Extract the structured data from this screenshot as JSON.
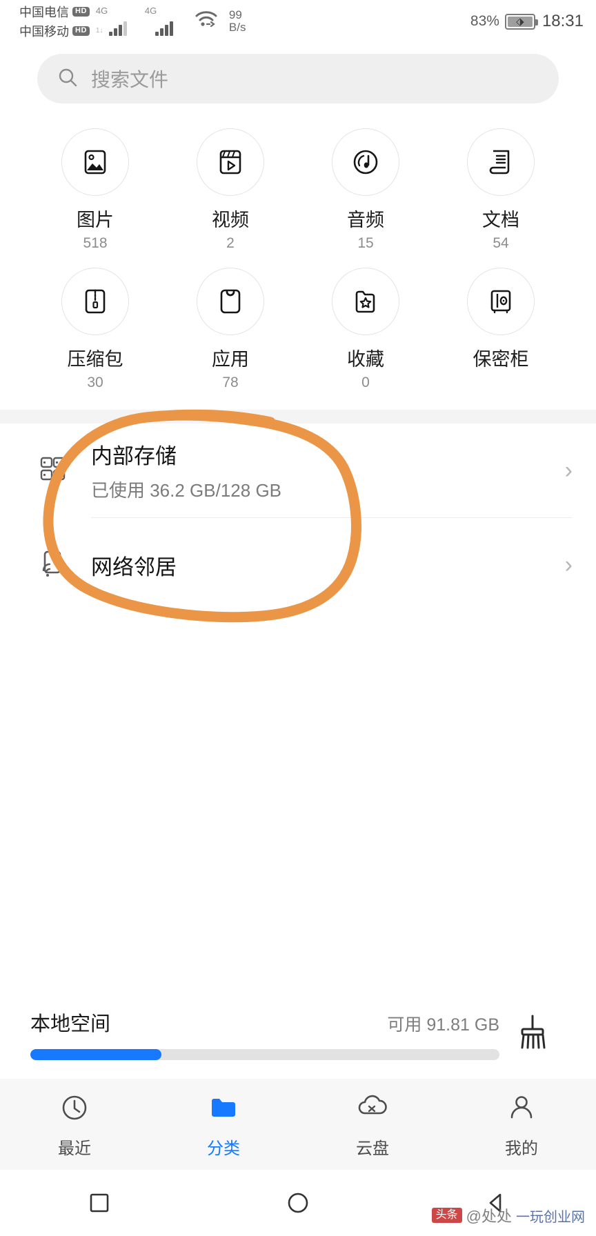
{
  "status_bar": {
    "carrier_1": "中国电信",
    "carrier_1_badge": "HD",
    "carrier_2": "中国移动",
    "carrier_2_badge": "HD",
    "network_1": "4G",
    "network_2": "4G",
    "net_speed_value": "99",
    "net_speed_unit": "B/s",
    "battery_percent": "83%",
    "time": "18:31"
  },
  "search": {
    "placeholder": "搜索文件",
    "icon": "search-icon"
  },
  "categories": [
    {
      "label": "图片",
      "count": "518",
      "icon": "image-icon"
    },
    {
      "label": "视频",
      "count": "2",
      "icon": "video-icon"
    },
    {
      "label": "音频",
      "count": "15",
      "icon": "audio-icon"
    },
    {
      "label": "文档",
      "count": "54",
      "icon": "document-icon"
    },
    {
      "label": "压缩包",
      "count": "30",
      "icon": "archive-icon"
    },
    {
      "label": "应用",
      "count": "78",
      "icon": "app-bag-icon"
    },
    {
      "label": "收藏",
      "count": "0",
      "icon": "favorites-folder-icon"
    },
    {
      "label": "保密柜",
      "count": "",
      "icon": "safe-box-icon"
    }
  ],
  "storage_list": [
    {
      "title": "内部存储",
      "subtitle": "已使用 36.2 GB/128 GB",
      "icon": "internal-storage-icon",
      "chevron": "›",
      "annotated": true
    },
    {
      "title": "网络邻居",
      "subtitle": "",
      "icon": "network-neighbors-icon",
      "chevron": "›",
      "annotated": false
    }
  ],
  "annotation": {
    "color": "#eb9546",
    "shape": "hand-drawn-ellipse",
    "target": "内部存储"
  },
  "local_space": {
    "title": "本地空间",
    "free_label": "可用 91.81 GB",
    "used_percent": 28,
    "bar_color": "#1779ff",
    "clean_icon": "broom-cleanup-icon"
  },
  "tabs": [
    {
      "label": "最近",
      "icon": "clock-icon",
      "active": false
    },
    {
      "label": "分类",
      "icon": "folder-icon",
      "active": true
    },
    {
      "label": "云盘",
      "icon": "cloud-icon",
      "active": false
    },
    {
      "label": "我的",
      "icon": "person-icon",
      "active": false
    }
  ],
  "nav_bar": [
    {
      "name": "recents-button",
      "icon": "square-icon"
    },
    {
      "name": "home-button",
      "icon": "circle-icon"
    },
    {
      "name": "back-button",
      "icon": "triangle-back-icon"
    }
  ],
  "watermark": {
    "logo": "头条",
    "author": "@处处",
    "site": "一玩创业网"
  },
  "colors": {
    "accent": "#1779ff",
    "annotation": "#eb9546",
    "background": "#ffffff",
    "band": "#f4f4f4"
  }
}
